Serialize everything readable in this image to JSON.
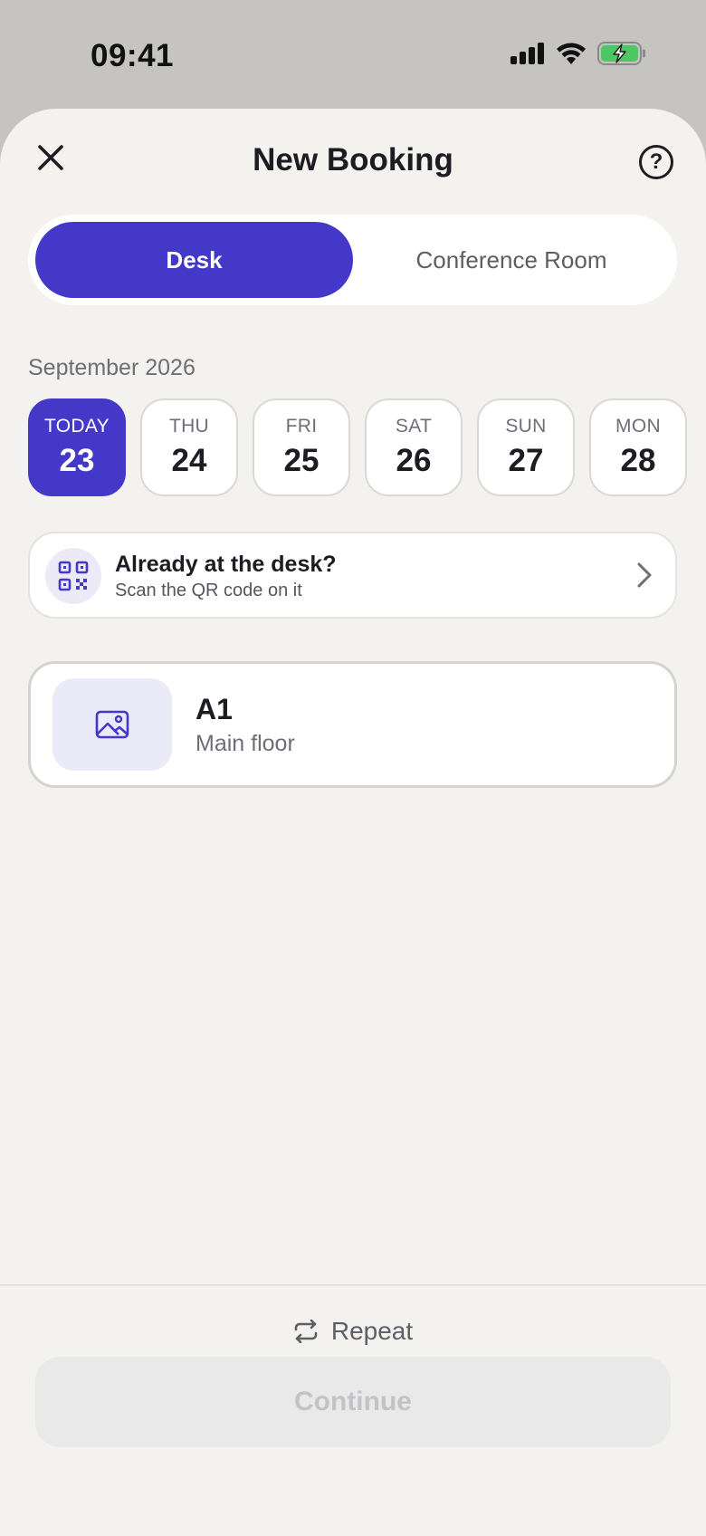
{
  "status_bar": {
    "time": "09:41",
    "icons": [
      "signal-icon",
      "wifi-icon",
      "battery-charging-icon"
    ]
  },
  "header": {
    "title": "New Booking",
    "close_icon": "close-icon",
    "help_label": "?"
  },
  "booking_type": {
    "options": [
      {
        "label": "Desk",
        "selected": true
      },
      {
        "label": "Conference Room",
        "selected": false
      }
    ]
  },
  "calendar": {
    "month_label": "September 2026",
    "days": [
      {
        "dow": "TODAY",
        "num": "23",
        "selected": true
      },
      {
        "dow": "THU",
        "num": "24",
        "selected": false
      },
      {
        "dow": "FRI",
        "num": "25",
        "selected": false
      },
      {
        "dow": "SAT",
        "num": "26",
        "selected": false
      },
      {
        "dow": "SUN",
        "num": "27",
        "selected": false
      },
      {
        "dow": "MON",
        "num": "28",
        "selected": false
      }
    ]
  },
  "qr_scan": {
    "title": "Already at the desk?",
    "subtitle": "Scan the QR code on it",
    "icon": "qr-code-icon"
  },
  "desk": {
    "name": "A1",
    "floor": "Main floor",
    "thumbnail_icon": "image-icon"
  },
  "footer": {
    "repeat_label": "Repeat",
    "continue_label": "Continue"
  },
  "colors": {
    "accent": "#4438c8",
    "sheet_background": "#f3f2ef",
    "status_bar_background": "#c5c4c0",
    "battery_fill": "#4cc764"
  }
}
